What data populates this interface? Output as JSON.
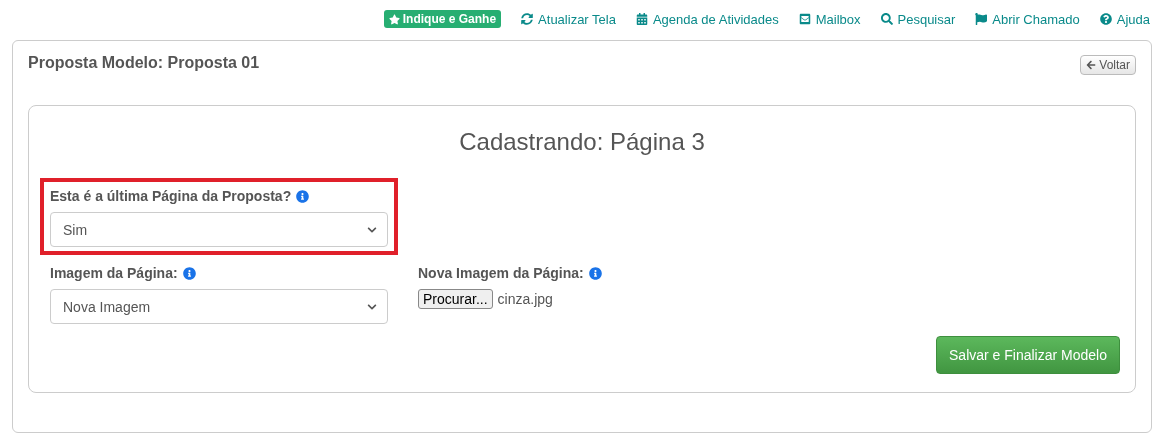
{
  "top_nav": {
    "badge": "Indique e Ganhe",
    "links": [
      "Atualizar Tela",
      "Agenda de Atividades",
      "Mailbox",
      "Pesquisar",
      "Abrir Chamado",
      "Ajuda"
    ]
  },
  "panel": {
    "title": "Proposta Modelo: Proposta 01",
    "back_button": "Voltar"
  },
  "form": {
    "heading": "Cadastrando: Página 3",
    "fields": [
      {
        "kind": "select",
        "label": "Esta é a última Página da Proposta?",
        "value": "Sim",
        "highlighted": true
      },
      {
        "kind": "select",
        "label": "Imagem da Página:",
        "value": "Nova Imagem",
        "highlighted": false
      },
      {
        "kind": "file",
        "label": "Nova Imagem da Página:",
        "button": "Procurar...",
        "value": "cinza.jpg",
        "highlighted": false
      }
    ],
    "submit": "Salvar e Finalizar Modelo"
  }
}
